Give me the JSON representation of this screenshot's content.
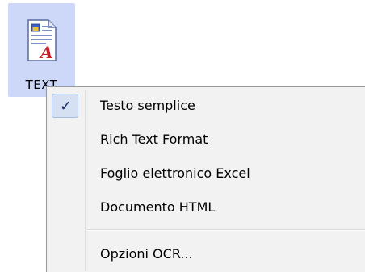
{
  "file_icon": {
    "label": "TEXT",
    "icon": "text-document-icon",
    "highlight_color": "#cdd7f8"
  },
  "context_menu": {
    "items": [
      {
        "label": "Testo semplice",
        "checked": true
      },
      {
        "label": "Rich Text Format",
        "checked": false
      },
      {
        "label": "Foglio elettronico Excel",
        "checked": false
      },
      {
        "label": "Documento HTML",
        "checked": false
      }
    ],
    "options_label": "Opzioni OCR...",
    "check_glyph": "✓",
    "colors": {
      "background": "#f2f2f2",
      "check_highlight": "#d5e1f2",
      "check_border": "#a4bbe2"
    }
  }
}
